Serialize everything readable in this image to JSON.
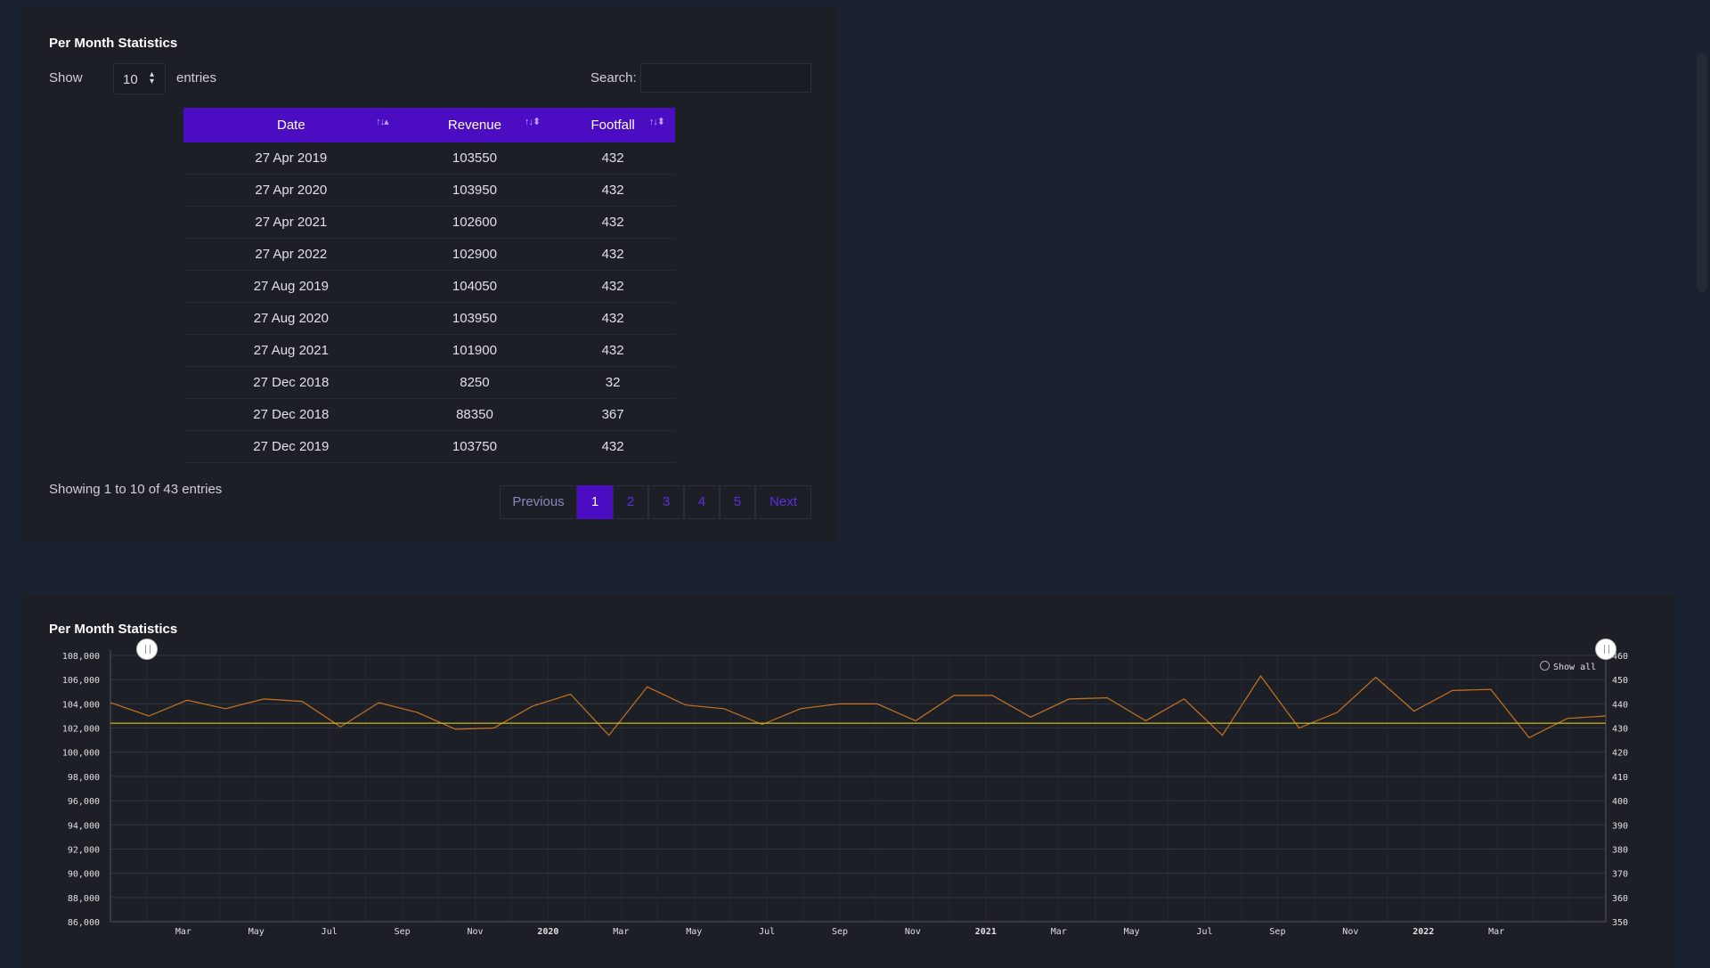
{
  "table_card": {
    "title": "Per Month Statistics",
    "show_label": "Show",
    "entries_value": "10",
    "entries_label": "entries",
    "search_label": "Search:",
    "search_value": "",
    "columns": [
      "Date",
      "Revenue",
      "Footfall"
    ],
    "rows": [
      [
        "27 Apr 2019",
        "103550",
        "432"
      ],
      [
        "27 Apr 2020",
        "103950",
        "432"
      ],
      [
        "27 Apr 2021",
        "102600",
        "432"
      ],
      [
        "27 Apr 2022",
        "102900",
        "432"
      ],
      [
        "27 Aug 2019",
        "104050",
        "432"
      ],
      [
        "27 Aug 2020",
        "103950",
        "432"
      ],
      [
        "27 Aug 2021",
        "101900",
        "432"
      ],
      [
        "27 Dec 2018",
        "8250",
        "32"
      ],
      [
        "27 Dec 2018",
        "88350",
        "367"
      ],
      [
        "27 Dec 2019",
        "103750",
        "432"
      ]
    ],
    "info": "Showing 1 to 10 of 43 entries",
    "pagination": {
      "previous": "Previous",
      "pages": [
        "1",
        "2",
        "3",
        "4",
        "5"
      ],
      "active_page": "1",
      "next": "Next"
    }
  },
  "chart_card": {
    "title": "Per Month Statistics",
    "show_all": "Show all"
  },
  "colors": {
    "accent": "#4b0cc2",
    "revenue_line": "#c6731f",
    "footfall_line": "#c9b81a",
    "background": "#1a2130",
    "card": "#1d1f27"
  },
  "chart_data": {
    "type": "line",
    "x_ticks": [
      "Mar",
      "May",
      "Jul",
      "Sep",
      "Nov",
      "2020",
      "Mar",
      "May",
      "Jul",
      "Sep",
      "Nov",
      "2021",
      "Mar",
      "May",
      "Jul",
      "Sep",
      "Nov",
      "2022",
      "Mar"
    ],
    "y_left_ticks": [
      "108,000",
      "106,000",
      "104,000",
      "102,000",
      "100,000",
      "98,000",
      "96,000",
      "94,000",
      "92,000",
      "90,000",
      "88,000",
      "86,000"
    ],
    "y_right_ticks": [
      "460",
      "450",
      "440",
      "430",
      "420",
      "410",
      "400",
      "390",
      "380",
      "370",
      "360",
      "350"
    ],
    "ylim_left": [
      86000,
      108000
    ],
    "ylim_right": [
      350,
      460
    ],
    "x_range_months": [
      0,
      41
    ],
    "grid": true,
    "series": [
      {
        "axis": "left",
        "values": [
          104100,
          103000,
          104300,
          103600,
          104400,
          104200,
          102100,
          104100,
          103300,
          101900,
          102000,
          103800,
          104800,
          101400,
          105400,
          103900,
          103600,
          102300,
          103600,
          104000,
          104000,
          102600,
          104700,
          104700,
          102900,
          104400,
          104500,
          102600,
          104400,
          101400,
          106300,
          102000,
          103300,
          106200,
          103400,
          105100,
          105200,
          101200,
          102800,
          103000
        ]
      },
      {
        "axis": "right",
        "values": [
          432,
          432,
          432,
          432,
          432,
          432,
          432,
          432,
          432,
          432,
          432,
          432,
          432,
          432,
          432,
          432,
          432,
          432,
          432,
          432,
          432,
          432,
          432,
          432,
          432,
          432,
          432,
          432,
          432,
          432,
          432,
          432,
          432,
          432,
          432,
          432,
          432,
          432,
          432,
          432
        ]
      }
    ]
  }
}
